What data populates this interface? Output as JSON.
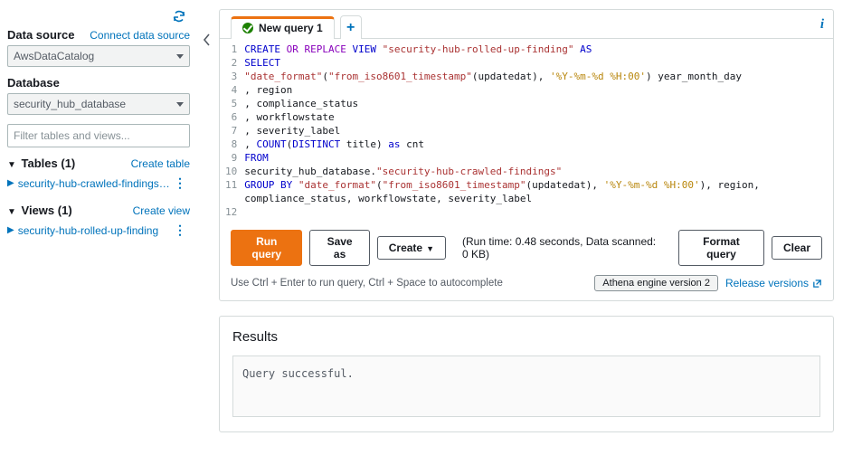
{
  "sidebar": {
    "data_source_label": "Data source",
    "connect_link": "Connect data source",
    "data_source_value": "AwsDataCatalog",
    "database_label": "Database",
    "database_value": "security_hub_database",
    "filter_placeholder": "Filter tables and views...",
    "tables_header": "Tables (1)",
    "create_table_link": "Create table",
    "tables": [
      {
        "label": "security-hub-crawled-findings (Partiti..."
      }
    ],
    "views_header": "Views (1)",
    "create_view_link": "Create view",
    "views": [
      {
        "label": "security-hub-rolled-up-finding"
      }
    ]
  },
  "tabs": {
    "active_label": "New query 1"
  },
  "editor": {
    "gutter": " 1\n 2\n 3\n 4\n 5\n 6\n 7\n 8\n 9\n10\n11\n\n12",
    "code_html": "<span class=\"tok-kw\">CREATE</span> <span class=\"tok-kw2\">OR REPLACE</span> <span class=\"tok-kw\">VIEW</span> <span class=\"tok-red\">\"security-hub-rolled-up-finding\"</span> <span class=\"tok-kw\">AS</span>\n<span class=\"tok-kw\">SELECT</span>\n<span class=\"tok-red\">\"date_format\"</span>(<span class=\"tok-red\">\"from_iso8601_timestamp\"</span>(updatedat), <span class=\"tok-str\">'%Y-%m-%d %H:00'</span>) year_month_day\n, region\n, compliance_status\n, workflowstate\n, severity_label\n, <span class=\"tok-kw\">COUNT</span>(<span class=\"tok-kw\">DISTINCT</span> title) <span class=\"tok-kw\">as</span> cnt\n<span class=\"tok-kw\">FROM</span>\nsecurity_hub_database.<span class=\"tok-red\">\"security-hub-crawled-findings\"</span>\n<span class=\"tok-kw\">GROUP BY</span> <span class=\"tok-red\">\"date_format\"</span>(<span class=\"tok-red\">\"from_iso8601_timestamp\"</span>(updatedat), <span class=\"tok-str\">'%Y-%m-%d %H:00'</span>), region,\ncompliance_status, workflowstate, severity_label\n"
  },
  "actions": {
    "run": "Run query",
    "save_as": "Save as",
    "create": "Create",
    "status": "(Run time: 0.48 seconds, Data scanned: 0 KB)",
    "format": "Format query",
    "clear": "Clear",
    "hint": "Use Ctrl + Enter to run query, Ctrl + Space to autocomplete",
    "engine_pill": "Athena engine version 2",
    "release_link": "Release versions"
  },
  "results": {
    "title": "Results",
    "message": "Query successful."
  }
}
